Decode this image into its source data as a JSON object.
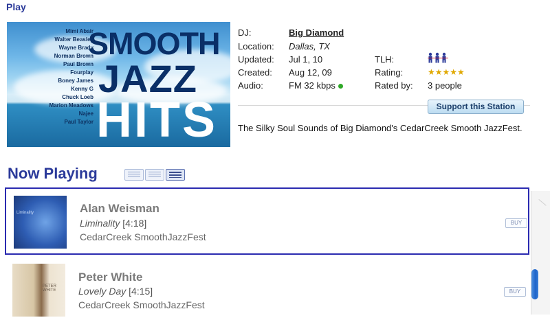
{
  "nav": {
    "play_label": "Play"
  },
  "album_art": {
    "artists": [
      "Mimi Abair",
      "Walter Beasley",
      "Wayne Brady",
      "Norman Brown",
      "Paul Brown",
      "Fourplay",
      "Boney James",
      "Kenny G",
      "Chuck Loeb",
      "Marion Meadows",
      "Najee",
      "Paul Taylor"
    ],
    "title_line1": "SMOOTH",
    "title_line2": "JAZZ",
    "title_line3": "HITS"
  },
  "station": {
    "dj_label": "DJ:",
    "dj_value": "Big Diamond",
    "location_label": "Location:",
    "location_value": "Dallas, TX",
    "updated_label": "Updated:",
    "updated_value": "Jul 1, 10",
    "created_label": "Created:",
    "created_value": "Aug 12, 09",
    "audio_label": "Audio:",
    "audio_value": "FM 32 kbps",
    "tlh_label": "TLH:",
    "rating_label": "Rating:",
    "rating_stars": "★★★★★",
    "rated_by_label": "Rated by:",
    "rated_by_value": "3 people",
    "support_button": "Support this Station",
    "description": "The Silky Soul Sounds of Big Diamond's CedarCreek Smooth JazzFest."
  },
  "now_playing": {
    "title": "Now Playing",
    "tracks": [
      {
        "artist": "Alan Weisman",
        "song": "Liminality",
        "duration": "[4:18]",
        "album": "CedarCreek SmoothJazzFest",
        "buy": "BUY",
        "cover_text": "Liminality"
      },
      {
        "artist": "Peter White",
        "song": "Lovely Day",
        "duration": "[4:15]",
        "album": "CedarCreek SmoothJazzFest",
        "buy": "BUY",
        "cover_text": "PETER WHITE"
      }
    ]
  },
  "colors": {
    "accent": "#2b3a9a",
    "selection_border": "#2a2ab0",
    "status_dot": "#2fa828",
    "stars": "#e0a800"
  }
}
